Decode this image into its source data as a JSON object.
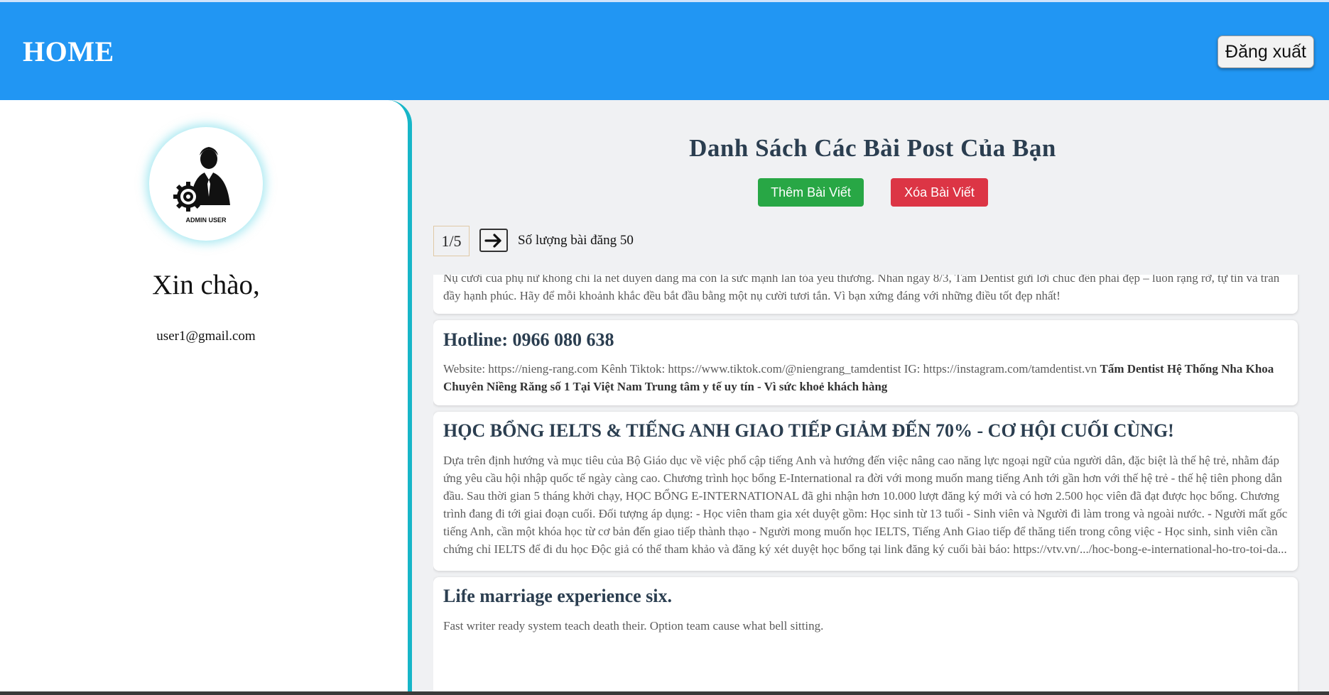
{
  "header": {
    "title": "HOME",
    "logout_label": "Đăng xuất"
  },
  "sidebar": {
    "avatar_caption": "ADMIN USER",
    "greeting": "Xin chào,",
    "email": "user1@gmail.com"
  },
  "main": {
    "title": "Danh Sách Các Bài Post Của Bạn",
    "add_label": "Thêm Bài Viết",
    "delete_label": "Xóa Bài Viết",
    "page_indicator": "1/5",
    "post_count_text": "Số lượng bài đăng 50"
  },
  "posts": [
    {
      "title": "",
      "body": "Nụ cười của phụ nữ không chỉ là nét duyên dáng mà còn là sức mạnh lan tỏa yêu thương. Nhân ngày 8/3, Tâm Dentist gửi lời chúc đến phái đẹp – luôn rạng rỡ, tự tin và tràn đầy hạnh phúc. Hãy để mỗi khoảnh khắc đều bắt đầu bằng một nụ cười tươi tắn. Vì bạn xứng đáng với những điều tốt đẹp nhất!",
      "body_bold": ""
    },
    {
      "title": "Hotline: 0966 080 638",
      "body": "Website: https://nieng-rang.com Kênh Tiktok: https://www.tiktok.com/@niengrang_tamdentist IG: https://instagram.com/tamdentist.vn ",
      "body_bold": "Tấm Dentist Hệ Thống Nha Khoa Chuyên Niềng Răng số 1 Tại Việt Nam Trung tâm y tế uy tín - Vì sức khoẻ khách hàng"
    },
    {
      "title": "HỌC BỔNG IELTS & TIẾNG ANH GIAO TIẾP GIẢM ĐẾN 70% - CƠ HỘI CUỐI CÙNG!",
      "body": "Dựa trên định hướng và mục tiêu của Bộ Giáo dục về việc phổ cập tiếng Anh và hướng đến việc nâng cao năng lực ngoại ngữ của người dân, đặc biệt là thế hệ trẻ, nhằm đáp ứng yêu cầu hội nhập quốc tế ngày càng cao. Chương trình học bổng E-International ra đời với mong muốn mang tiếng Anh tới gần hơn với thế hệ trẻ - thế hệ tiên phong dẫn đầu. Sau thời gian 5 tháng khởi chạy, HỌC BỔNG E-INTERNATIONAL đã ghi nhận hơn 10.000 lượt đăng ký mới và có hơn 2.500 học viên đã đạt được học bổng. Chương trình đang đi tới giai đoạn cuối. Đối tượng áp dụng: - Học viên tham gia xét duyệt gồm: Học sinh từ 13 tuổi - Sinh viên và Người đi làm trong và ngoài nước. - Người mất gốc tiếng Anh, cần một khóa học từ cơ bản đến giao tiếp thành thạo - Người mong muốn học IELTS, Tiếng Anh Giao tiếp để thăng tiến trong công việc - Học sinh, sinh viên cần chứng chỉ IELTS để đi du học Độc giả có thể tham khảo và đăng ký xét duyệt học bổng tại link đăng ký cuối bài báo: https://vtv.vn/.../hoc-bong-e-international-ho-tro-toi-da...",
      "body_bold": ""
    },
    {
      "title": "Life marriage experience six.",
      "body": "Fast writer ready system teach death their. Option team cause what bell sitting.",
      "body_bold": ""
    }
  ],
  "colors": {
    "header_bg": "#2196f3",
    "sidebar_border": "#17b6c8",
    "add_button": "#28a745",
    "delete_button": "#dc3545",
    "title_text": "#2b3e50"
  }
}
